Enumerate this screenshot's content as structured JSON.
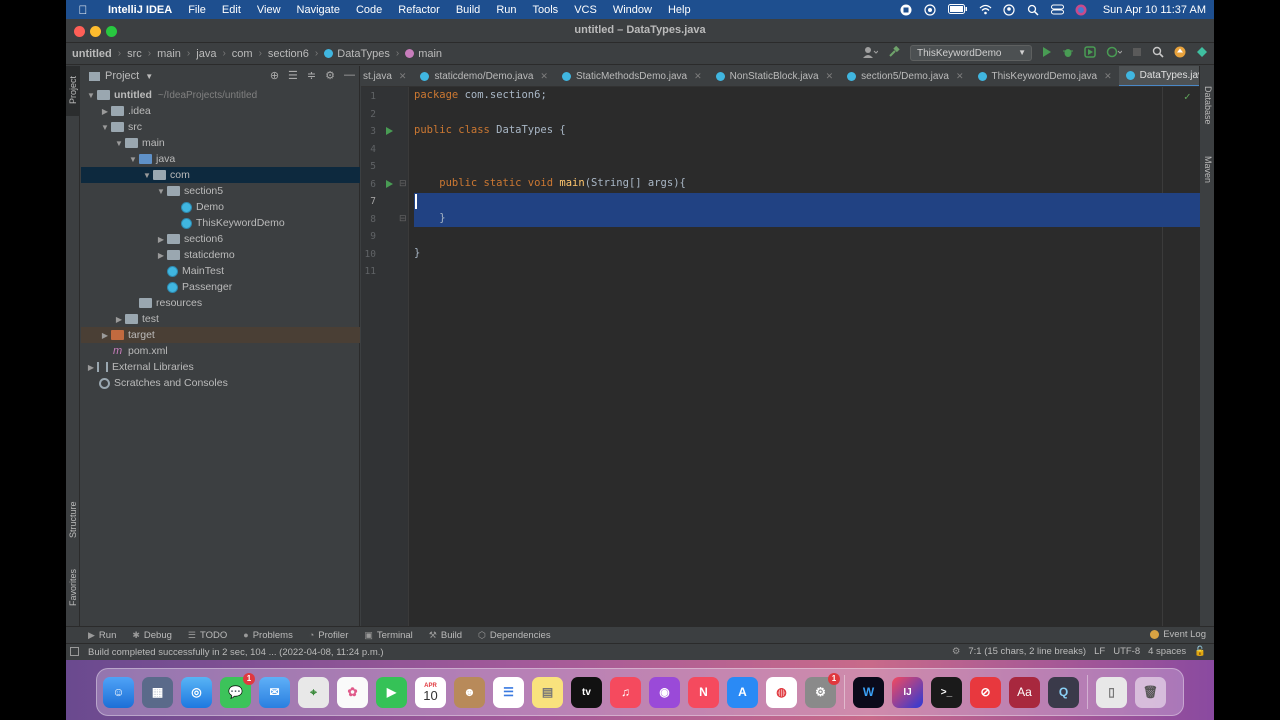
{
  "menubar": {
    "app": "IntelliJ IDEA",
    "items": [
      "File",
      "Edit",
      "View",
      "Navigate",
      "Code",
      "Refactor",
      "Build",
      "Run",
      "Tools",
      "VCS",
      "Window",
      "Help"
    ],
    "clock": "Sun Apr 10  11:37 AM"
  },
  "window": {
    "title": "untitled – DataTypes.java"
  },
  "breadcrumbs": [
    "untitled",
    "src",
    "main",
    "java",
    "com",
    "section6",
    "DataTypes",
    "main"
  ],
  "run_config": "ThisKeywordDemo",
  "project": {
    "label": "Project",
    "root": "untitled",
    "root_path": "~/IdeaProjects/untitled",
    "nodes": {
      "idea": ".idea",
      "src": "src",
      "main": "main",
      "java": "java",
      "com": "com",
      "section5": "section5",
      "demo": "Demo",
      "thiskw": "ThisKeywordDemo",
      "section6": "section6",
      "staticdemo": "staticdemo",
      "maintest": "MainTest",
      "passenger": "Passenger",
      "resources": "resources",
      "test": "test",
      "target": "target",
      "pom": "pom.xml",
      "extlib": "External Libraries",
      "scratches": "Scratches and Consoles"
    }
  },
  "tabs": [
    "st.java",
    "staticdemo/Demo.java",
    "StaticMethodsDemo.java",
    "NonStaticBlock.java",
    "section5/Demo.java",
    "ThisKeywordDemo.java",
    "DataTypes.java"
  ],
  "editor": {
    "line_numbers": [
      "1",
      "2",
      "3",
      "4",
      "5",
      "6",
      "7",
      "8",
      "9",
      "10",
      "11"
    ],
    "l1_kw": "package",
    "l1_rest": " com.section6;",
    "l3_kw": "public class",
    "l3_rest": " DataTypes {",
    "l6_kw": "    public static void",
    "l6_fn": " main",
    "l6_rest": "(String[] args){",
    "l8": "    }",
    "l10": "}"
  },
  "stripes": {
    "left_top": "Project",
    "left_mid": "Structure",
    "left_bot": "Favorites",
    "right_top": "Database",
    "right_bot": "Maven"
  },
  "toolwindows": [
    "Run",
    "Debug",
    "TODO",
    "Problems",
    "Profiler",
    "Terminal",
    "Build",
    "Dependencies"
  ],
  "event_log": "Event Log",
  "status": {
    "message": "Build completed successfully in 2 sec, 104 ... (2022-04-08, 11:24 p.m.)",
    "position": "7:1 (15 chars, 2 line breaks)",
    "line_sep": "LF",
    "encoding": "UTF-8",
    "indent": "4 spaces"
  },
  "dock": {
    "calendar_month": "APR",
    "calendar_day": "10",
    "messages_badge": "1",
    "settings_badge": "1"
  }
}
